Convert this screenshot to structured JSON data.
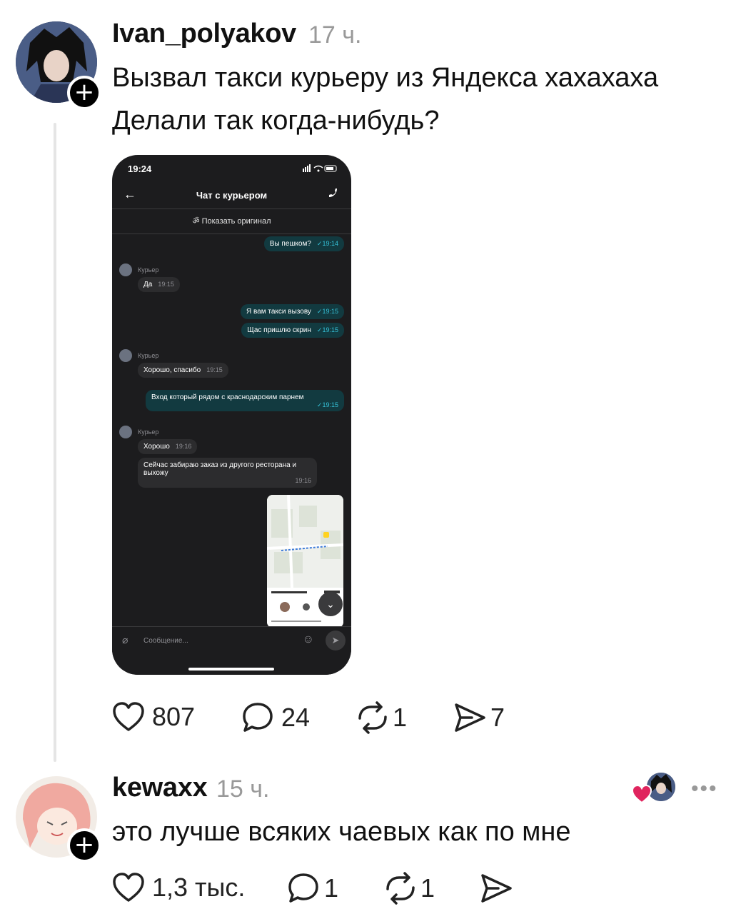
{
  "post": {
    "username": "Ivan_polyakov",
    "time": "17 ч.",
    "text_line1": "Вызвал такси курьеру из Яндекса хахахаха",
    "text_line2": "Делали так когда-нибудь?",
    "likes": "807",
    "comments": "24",
    "reposts": "1",
    "shares": "7"
  },
  "screenshot": {
    "status_time": "19:24",
    "title": "Чат с курьером",
    "show_original": "Показать оригинал",
    "messages": [
      {
        "dir": "out",
        "text": "Вы пешком?",
        "time": "19:14"
      },
      {
        "dir": "sender",
        "text": "Курьер"
      },
      {
        "dir": "in",
        "text": "Да",
        "time": "19:15"
      },
      {
        "dir": "out",
        "text": "Я вам такси вызову",
        "time": "19:15"
      },
      {
        "dir": "out",
        "text": "Щас пришлю скрин",
        "time": "19:15"
      },
      {
        "dir": "sender",
        "text": "Курьер"
      },
      {
        "dir": "in",
        "text": "Хорошо, спасибо",
        "time": "19:15"
      },
      {
        "dir": "out",
        "text": "Вход который рядом с краснодарским парнем",
        "time": "19:15"
      },
      {
        "dir": "sender",
        "text": "Курьер"
      },
      {
        "dir": "in",
        "text": "Хорошо",
        "time": "19:16"
      },
      {
        "dir": "in",
        "text": "Сейчас забираю заказ из другого ресторана и выхожу",
        "time": "19:16"
      }
    ],
    "input_placeholder": "Сообщение..."
  },
  "reply": {
    "username": "kewaxx",
    "time": "15 ч.",
    "text": "это лучше всяких чаевых как по мне",
    "likes": "1,3 тыс.",
    "comments": "1",
    "reposts": "1"
  },
  "colors": {
    "like_heart": "#e0245e",
    "thread_line": "#e5e5e5",
    "out_bubble": "#123a40",
    "check_time": "#35c0d6"
  }
}
